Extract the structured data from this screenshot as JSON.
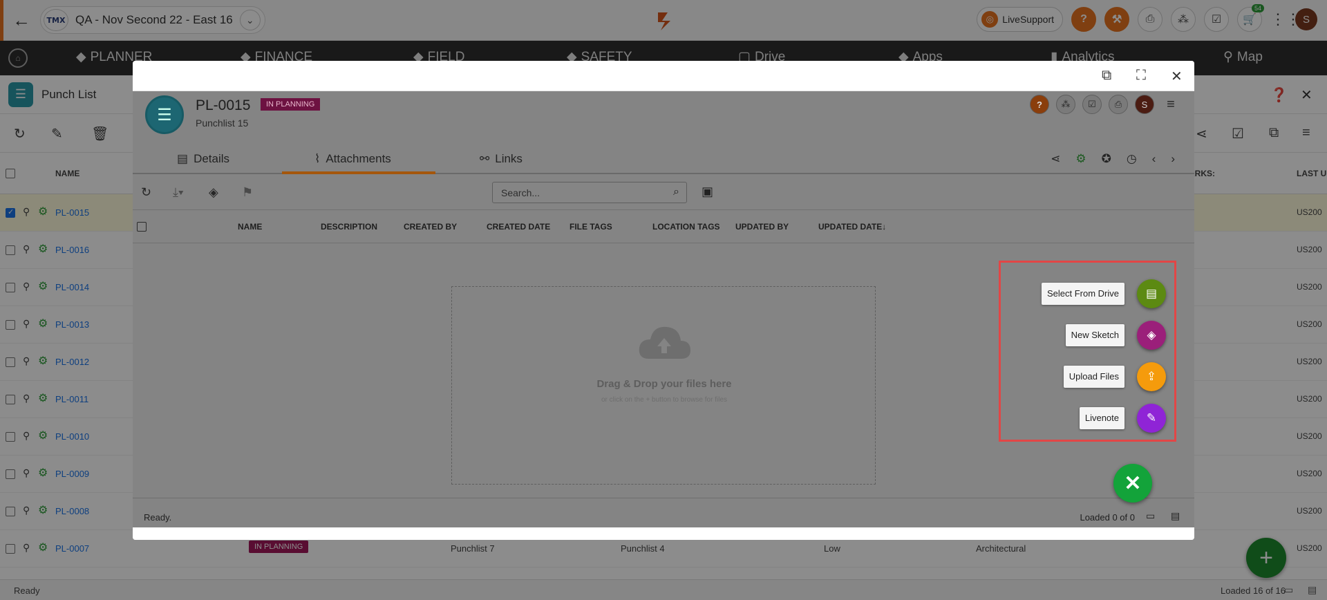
{
  "app": {
    "project_name": "QA - Nov Second 22 - East 16",
    "logo_text": "TMX",
    "live_support": "LiveSupport",
    "cart_badge": "54",
    "user_initial": "S"
  },
  "nav": {
    "items": [
      "PLANNER",
      "FINANCE",
      "FIELD",
      "SAFETY",
      "Drive",
      "Apps",
      "Analytics",
      "Map"
    ]
  },
  "page": {
    "title": "Punch List"
  },
  "table": {
    "columns": {
      "name": "NAME",
      "remarks": "ARKS:",
      "last": "LAST U"
    },
    "rows": [
      {
        "code": "PL-0015",
        "us": "US200",
        "selected": true
      },
      {
        "code": "PL-0016",
        "us": "US200"
      },
      {
        "code": "PL-0014",
        "us": "US200"
      },
      {
        "code": "PL-0013",
        "us": "US200"
      },
      {
        "code": "PL-0012",
        "us": "US200"
      },
      {
        "code": "PL-0011",
        "us": "US200"
      },
      {
        "code": "PL-0010",
        "us": "US200"
      },
      {
        "code": "PL-0009",
        "us": "US200"
      },
      {
        "code": "PL-0008",
        "us": "US200"
      },
      {
        "code": "PL-0007",
        "us": "US200",
        "status": "IN PLANNING",
        "title": "Punchlist 7",
        "sub": "Punchlist 4",
        "priority": "Low",
        "trade": "Architectural"
      }
    ]
  },
  "footer": {
    "status": "Ready",
    "loaded": "Loaded 16 of 16"
  },
  "modal": {
    "record": {
      "code": "PL-0015",
      "status": "IN PLANNING",
      "name": "Punchlist 15"
    },
    "tabs": [
      "Details",
      "Attachments",
      "Links"
    ],
    "active_tab": "Attachments",
    "search_placeholder": "Search...",
    "columns": [
      "NAME",
      "DESCRIPTION",
      "CREATED BY",
      "CREATED DATE",
      "FILE TAGS",
      "LOCATION TAGS",
      "UPDATED BY",
      "UPDATED DATE↓"
    ],
    "dropzone": {
      "title": "Drag & Drop your files here",
      "subtitle": "or click on the + button to browse for files"
    },
    "status": "Ready.",
    "loaded": "Loaded 0 of 0",
    "speed_dial": [
      {
        "label": "Select From Drive",
        "color": "#5c8a12",
        "icon": "drive-file-icon"
      },
      {
        "label": "New Sketch",
        "color": "#9b1f7a",
        "icon": "sketch-icon"
      },
      {
        "label": "Upload Files",
        "color": "#f59b0c",
        "icon": "upload-file-icon"
      },
      {
        "label": "Livenote",
        "color": "#8f24d6",
        "icon": "livenote-icon"
      }
    ]
  },
  "colors": {
    "accent_orange": "#e8731f",
    "link_blue": "#1a73e8",
    "fab_green": "#1e8a2e",
    "status_magenta": "#a2195b",
    "highlight_red": "#e24646"
  }
}
